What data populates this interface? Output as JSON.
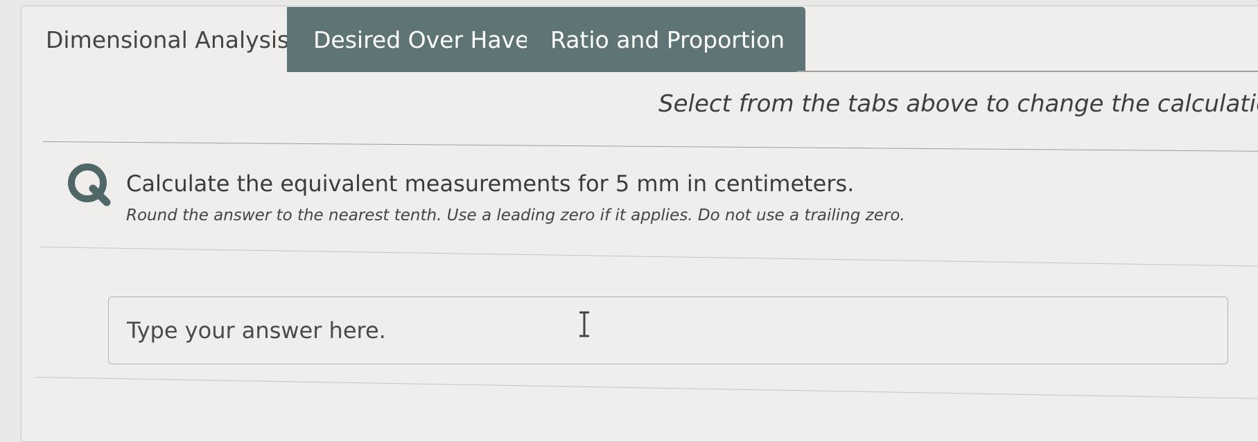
{
  "tabs": [
    {
      "label": "Dimensional Analysis",
      "active": true
    },
    {
      "label": "Desired Over Have",
      "active": false
    },
    {
      "label": "Ratio and Proportion",
      "active": false
    }
  ],
  "hint": "Select from the tabs above to change the calculation met",
  "question": {
    "icon": "question-q-icon",
    "icon_letter": "Q",
    "text": "Calculate the equivalent measurements for 5 mm in centimeters.",
    "instruction": "Round the answer to the nearest tenth. Use a leading zero if it applies. Do not use a trailing zero."
  },
  "answer": {
    "value": "",
    "placeholder": "Type your answer here."
  },
  "colors": {
    "tab_inactive_bg": "#5f7474",
    "q_icon": "#4f6767",
    "background": "#efeeec"
  },
  "cursor_icon": "text-cursor-icon"
}
